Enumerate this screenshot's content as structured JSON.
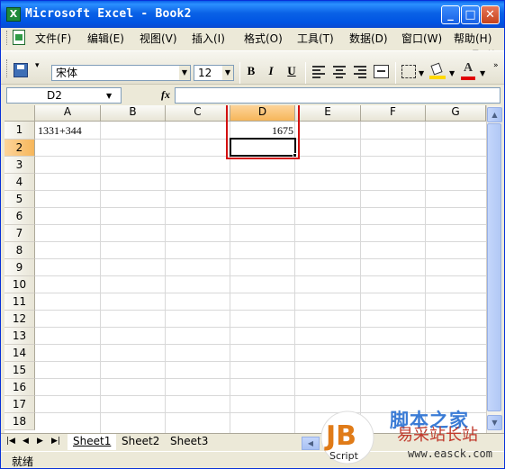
{
  "window": {
    "title": "Microsoft Excel - Book2",
    "app_icon": "X",
    "controls": {
      "minimize": "_",
      "maximize": "□",
      "close": "✕"
    }
  },
  "menu": {
    "items": [
      "文件(F)",
      "编辑(E)",
      "视图(V)",
      "插入(I)",
      "格式(O)",
      "工具(T)",
      "数据(D)",
      "窗口(W)",
      "帮助(H)"
    ],
    "doc_controls": {
      "minimize": "‒",
      "restore": "⧉",
      "close": "×"
    }
  },
  "toolbar": {
    "font_name": "宋体",
    "font_size": "12",
    "bold": "B",
    "italic": "I",
    "underline": "U",
    "font_color_label": "A",
    "colors": {
      "fill": "#ffd800",
      "font": "#e00000"
    }
  },
  "formula_bar": {
    "name_box": "D2",
    "fx": "fx",
    "content": ""
  },
  "sheet": {
    "columns": [
      "A",
      "B",
      "C",
      "D",
      "E",
      "F",
      "G"
    ],
    "rows": [
      "1",
      "2",
      "3",
      "4",
      "5",
      "6",
      "7",
      "8",
      "9",
      "10",
      "11",
      "12",
      "13",
      "14",
      "15",
      "16",
      "17",
      "18"
    ],
    "active_column": "D",
    "active_row": "2",
    "cells": {
      "A1": "1331+344",
      "D1": "1675"
    }
  },
  "tabs": {
    "sheets": [
      "Sheet1",
      "Sheet2",
      "Sheet3"
    ],
    "active": "Sheet1",
    "nav": [
      "|◀",
      "◀",
      "▶",
      "▶|"
    ]
  },
  "status": {
    "text": "就绪"
  },
  "watermark": {
    "logo": "JB",
    "logo_sub": "Script",
    "brand": "脚本之家",
    "site": "易采站长站",
    "url": "www.easck.com"
  },
  "colors": {
    "title_bar": "#0054e3",
    "active_header": "#f6b65a",
    "highlight_box": "#d21010"
  }
}
